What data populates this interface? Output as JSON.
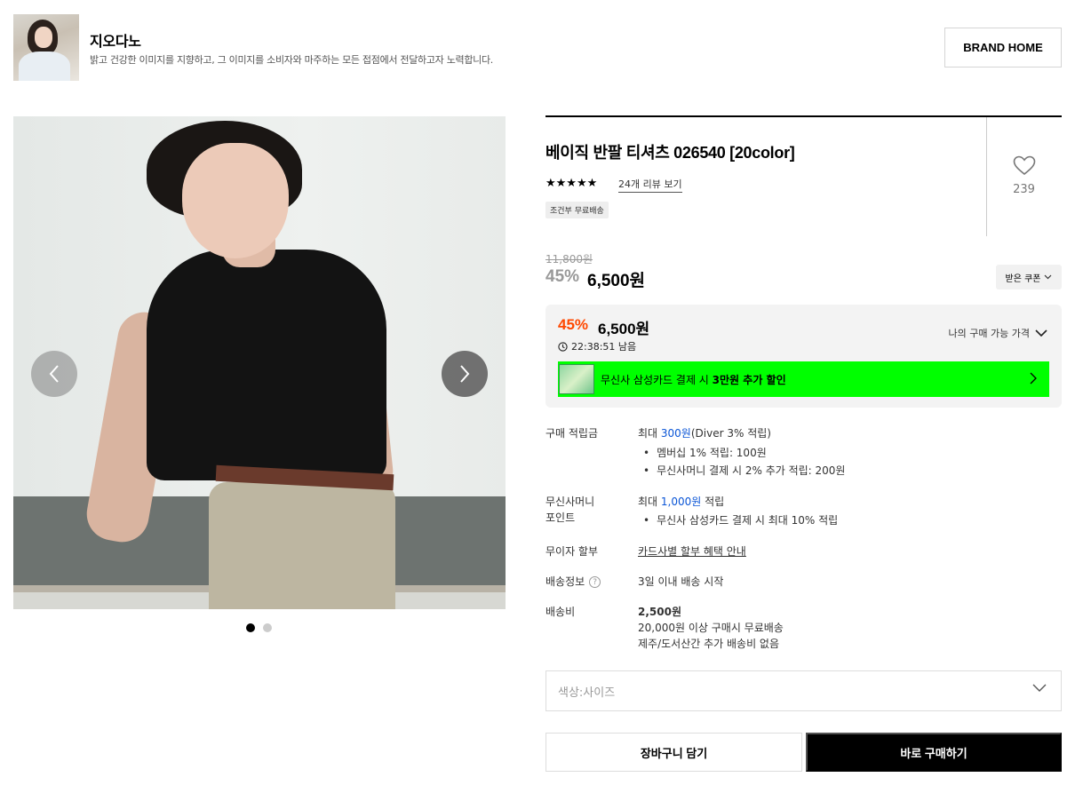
{
  "brand": {
    "name": "지오다노",
    "description": "밝고 건강한 이미지를 지향하고, 그 이미지를 소비자와 마주하는 모든 접점에서 전달하고자 노력합니다.",
    "home_button": "BRAND HOME"
  },
  "gallery": {
    "dots": 2,
    "active_index": 0
  },
  "product": {
    "title": "베이직 반팔 티셔츠 026540 [20color]",
    "stars": "★★★★★",
    "rating": 5,
    "review_link": "24개 리뷰 보기",
    "shipping_badge": "조건부 무료배송",
    "like_count": "239"
  },
  "price": {
    "original": "11,800원",
    "discount_rate": "45%",
    "sale": "6,500원",
    "coupon_button": "받은 쿠폰"
  },
  "price_box": {
    "discount_rate": "45%",
    "price": "6,500원",
    "timer": "22:38:51 남음",
    "my_price_label": "나의 구매 가능 가격",
    "card_banner_prefix": "무신사 삼성카드 결제 시 ",
    "card_banner_bold": "3만원 추가 할인",
    "accent_color": "#ff4800",
    "banner_color": "#00ff00"
  },
  "benefits": {
    "points_label": "구매 적립금",
    "points_prefix": "최대 ",
    "points_amount": "300원",
    "points_suffix": "(Diver 3% 적립)",
    "points_bullets": [
      "멤버십 1% 적립: 100원",
      "무신사머니 결제 시 2% 추가 적립: 200원"
    ],
    "money_label_1": "무신사머니",
    "money_label_2": "포인트",
    "money_prefix": "최대 ",
    "money_amount": "1,000원",
    "money_suffix": " 적립",
    "money_bullets": [
      "무신사 삼성카드 결제 시 최대 10% 적립"
    ],
    "installment_label": "무이자 할부",
    "installment_link": "카드사별 할부 혜택 안내",
    "delivery_label": "배송정보",
    "delivery_help": "?",
    "delivery_value": "3일 이내 배송 시작",
    "fee_label": "배송비",
    "fee_amount": "2,500원",
    "fee_line_2": "20,000원 이상 구매시 무료배송",
    "fee_line_3": "제주/도서산간 추가 배송비 없음",
    "link_color": "#0a55d6"
  },
  "options": {
    "placeholder": "색상:사이즈"
  },
  "actions": {
    "cart": "장바구니 담기",
    "buy": "바로 구매하기"
  }
}
